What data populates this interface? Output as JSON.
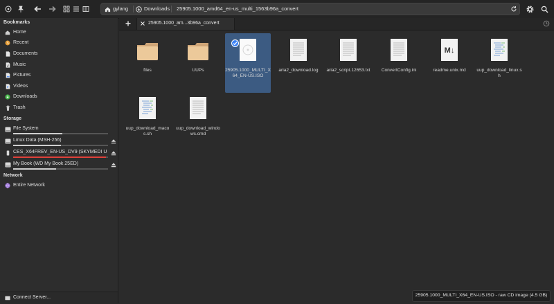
{
  "header": {
    "breadcrumbs": [
      {
        "label": "gylang",
        "icon": "home-icon"
      },
      {
        "label": "Downloads",
        "icon": "download-icon"
      },
      {
        "label": "25905.1000_amd64_en-us_multi_1563b96a_convert",
        "icon": ""
      }
    ]
  },
  "sidebar": {
    "bookmarks_heading": "Bookmarks",
    "bookmarks": [
      {
        "label": "Home",
        "icon": "home-icon"
      },
      {
        "label": "Recent",
        "icon": "recent-icon"
      },
      {
        "label": "Documents",
        "icon": "documents-icon"
      },
      {
        "label": "Music",
        "icon": "music-icon"
      },
      {
        "label": "Pictures",
        "icon": "pictures-icon"
      },
      {
        "label": "Videos",
        "icon": "videos-icon"
      },
      {
        "label": "Downloads",
        "icon": "downloads-icon"
      },
      {
        "label": "Trash",
        "icon": "trash-icon"
      }
    ],
    "storage_heading": "Storage",
    "storage": [
      {
        "label": "File System",
        "usage": 0.52,
        "bar_color": "#cfcfcf",
        "ejectable": false
      },
      {
        "label": "Linux Data (MSH-256)",
        "usage": 0.5,
        "bar_color": "#cfcfcf",
        "ejectable": true
      },
      {
        "label": "CES_X64FREV_EN-US_DV9 (SKYMEDI US...",
        "usage": 0.98,
        "bar_color": "#e0403a",
        "ejectable": true
      },
      {
        "label": "My Book (WD My Book 25ED)",
        "usage": 0.45,
        "bar_color": "#cfcfcf",
        "ejectable": true
      }
    ],
    "network_heading": "Network",
    "network": [
      {
        "label": "Entire Network",
        "icon": "network-icon"
      }
    ],
    "connect_label": "Connect Server..."
  },
  "tabs": [
    {
      "label": "25905.1000_am...3b96a_convert"
    }
  ],
  "files": [
    {
      "name": "files",
      "kind": "folder"
    },
    {
      "name": "UUPs",
      "kind": "folder"
    },
    {
      "name": "25905.1000_MULTI_X64_EN-US.ISO",
      "kind": "iso",
      "selected": true
    },
    {
      "name": "aria2_download.log",
      "kind": "text"
    },
    {
      "name": "aria2_script.12653.txt",
      "kind": "text"
    },
    {
      "name": "ConvertConfig.ini",
      "kind": "text"
    },
    {
      "name": "readme.unix.md",
      "kind": "markdown"
    },
    {
      "name": "uup_download_linux.sh",
      "kind": "script"
    },
    {
      "name": "uup_download_macos.sh",
      "kind": "script"
    },
    {
      "name": "uup_download_windows.cmd",
      "kind": "text"
    }
  ],
  "status": {
    "text": "25905.1000_MULTI_X64_EN-US.ISO - raw CD image (4.5 GB)"
  },
  "colors": {
    "selection": "#3c5b82",
    "accent": "#3b82f6",
    "folder": "#e9c89a"
  }
}
